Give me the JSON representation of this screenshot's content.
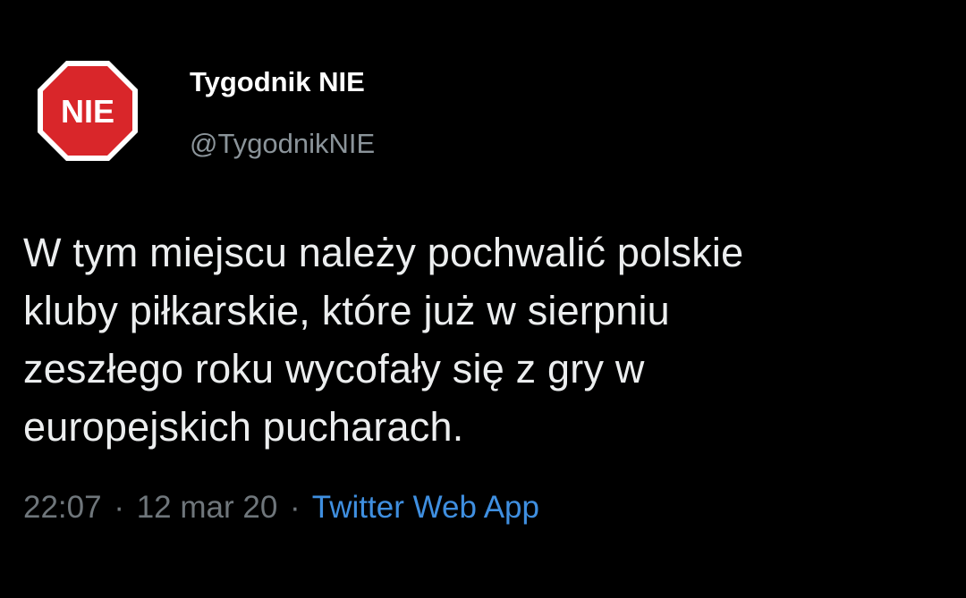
{
  "account": {
    "display_name": "Tygodnik NIE",
    "handle": "@TygodnikNIE",
    "avatar_text": "NIE",
    "avatar_color": "#d9262a"
  },
  "tweet": {
    "lines": [
      "W tym miejscu należy pochwalić polskie",
      "kluby piłkarskie, które już w sierpniu",
      "zeszłego roku wycofały się z gry w",
      "europejskich pucharach."
    ]
  },
  "meta": {
    "time": "22:07",
    "separator": "·",
    "date": "12 mar 20",
    "source": "Twitter Web App"
  },
  "colors": {
    "background": "#000000",
    "link": "#3f8fe0",
    "muted": "#6f767b"
  }
}
